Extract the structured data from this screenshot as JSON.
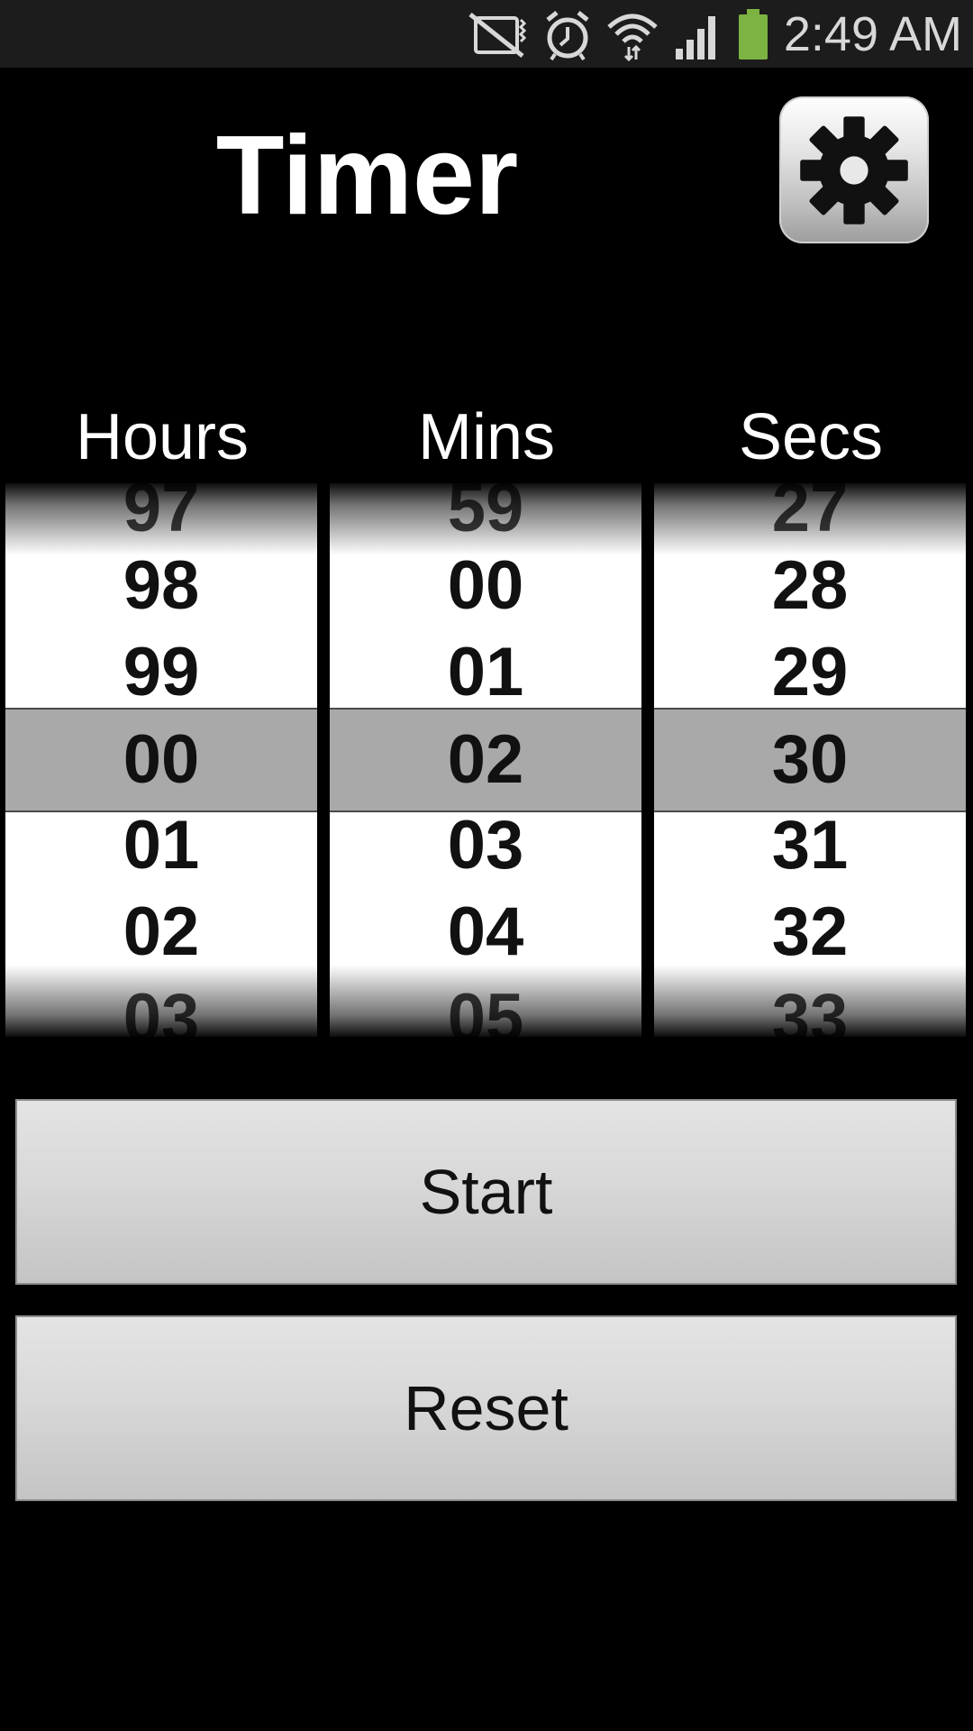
{
  "status_bar": {
    "time": "2:49 AM",
    "icons": [
      "no-sim-icon",
      "alarm-icon",
      "wifi-icon",
      "signal-icon",
      "battery-icon"
    ],
    "battery_color": "#7cb342"
  },
  "header": {
    "title": "Timer",
    "settings_icon": "gear-icon"
  },
  "columns": [
    {
      "label": "Hours",
      "values": [
        "97",
        "98",
        "99",
        "00",
        "01",
        "02",
        "03"
      ],
      "selected": "00"
    },
    {
      "label": "Mins",
      "values": [
        "59",
        "00",
        "01",
        "02",
        "03",
        "04",
        "05"
      ],
      "selected": "02"
    },
    {
      "label": "Secs",
      "values": [
        "27",
        "28",
        "29",
        "30",
        "31",
        "32",
        "33"
      ],
      "selected": "30"
    }
  ],
  "buttons": {
    "start": "Start",
    "reset": "Reset"
  },
  "colors": {
    "background": "#000000",
    "selection_band": "#a9a9a9",
    "status_bar": "#1c1c1c"
  }
}
